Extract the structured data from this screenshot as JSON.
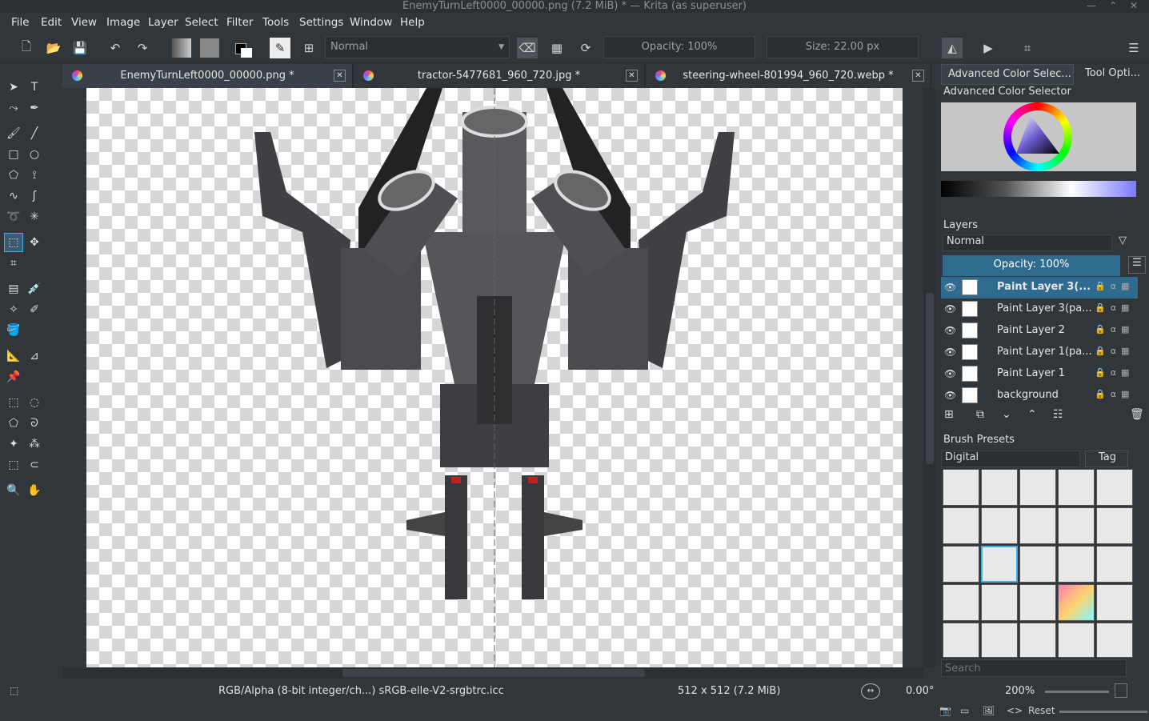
{
  "window": {
    "title": "EnemyTurnLeft0000_00000.png (7.2 MiB)  * — Krita (as superuser)"
  },
  "menu": [
    "File",
    "Edit",
    "View",
    "Image",
    "Layer",
    "Select",
    "Filter",
    "Tools",
    "Settings",
    "Window",
    "Help"
  ],
  "toolbar": {
    "blend_mode": "Normal",
    "opacity_label": "Opacity: 100%",
    "size_label": "Size: 22.00 px"
  },
  "tabs": [
    {
      "label": "EnemyTurnLeft0000_00000.png *"
    },
    {
      "label": "tractor-5477681_960_720.jpg *"
    },
    {
      "label": "steering-wheel-801994_960_720.webp *"
    }
  ],
  "dock_tabs": [
    "Advanced Color Selec...",
    "Tool Opti..."
  ],
  "color_selector": {
    "title": "Advanced Color Selector"
  },
  "layers_panel": {
    "title": "Layers",
    "blend_mode": "Normal",
    "opacity_label": "Opacity:  100%",
    "layers": [
      {
        "name": "Paint Layer 3(...",
        "selected": true
      },
      {
        "name": "Paint Layer 3(pa...",
        "selected": false
      },
      {
        "name": "Paint Layer 2",
        "selected": false
      },
      {
        "name": "Paint Layer 1(pa...",
        "selected": false
      },
      {
        "name": "Paint Layer 1",
        "selected": false
      },
      {
        "name": "background",
        "selected": false
      }
    ]
  },
  "brush_presets": {
    "title": "Brush Presets",
    "tag_value": "Digital",
    "tag_button": "Tag",
    "search_placeholder": "Search"
  },
  "status": {
    "color_info": "RGB/Alpha (8-bit integer/ch...)  sRGB-elle-V2-srgbtrc.icc",
    "image_size": "512 x 512 (7.2 MiB)",
    "rotation": "0.00°",
    "zoom": "200%",
    "reset_label": "Reset"
  },
  "colors": {
    "bg": "#31363b",
    "accent": "#3daee9",
    "selected_layer": "#2f6a8f"
  }
}
